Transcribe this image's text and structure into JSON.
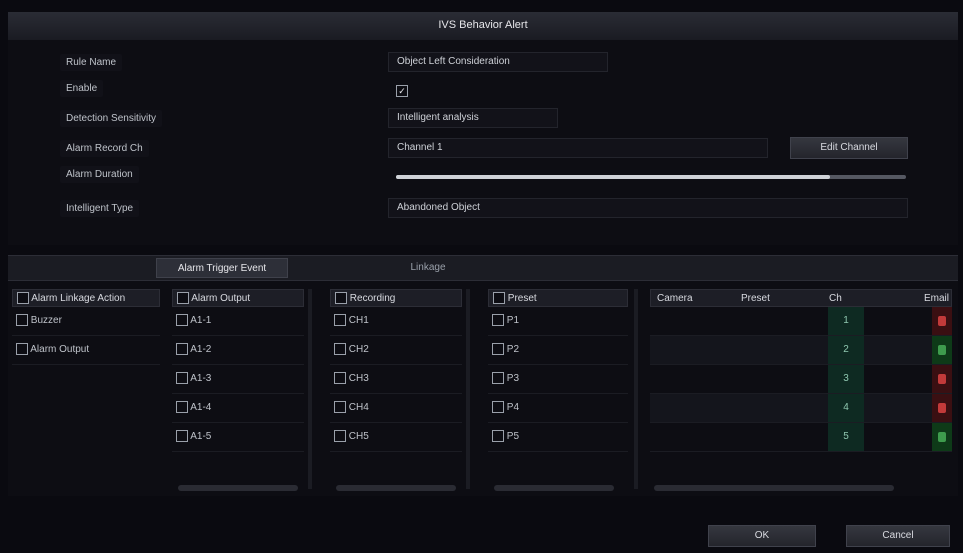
{
  "window": {
    "title": "IVS Behavior Alert"
  },
  "form": {
    "rows": [
      {
        "label": "Rule Name",
        "value": "Object Left Consideration"
      },
      {
        "label": "Enable",
        "checked": true
      },
      {
        "label": "Detection Sensitivity",
        "value": "Intelligent analysis"
      },
      {
        "label": "Alarm Record Ch",
        "value": "Channel 1",
        "button": "Edit Channel"
      },
      {
        "label": "Alarm Duration",
        "slider": 0.85
      },
      {
        "label": "Intelligent Type",
        "value": "Abandoned Object"
      }
    ]
  },
  "tabs": [
    {
      "label": "",
      "active": false
    },
    {
      "label": "Alarm Trigger Event",
      "active": true
    },
    {
      "label": "Linkage",
      "active": false
    }
  ],
  "columns": [
    {
      "head": "Alarm Linkage Action",
      "items": [
        "Buzzer",
        "Alarm Output"
      ]
    },
    {
      "head": "Alarm Output",
      "items": [
        "A1-1",
        "A1-2",
        "A1-3",
        "A1-4",
        "A1-5"
      ]
    },
    {
      "head": "Recording",
      "items": [
        "CH1",
        "CH2",
        "CH3",
        "CH4",
        "CH5"
      ]
    },
    {
      "head": "Preset",
      "items": [
        "P1",
        "P2",
        "P3",
        "P4",
        "P5"
      ]
    }
  ],
  "table": {
    "headers": [
      "Camera",
      "Preset",
      "Ch",
      "Email"
    ],
    "rows": [
      {
        "ch": "1",
        "email": "red"
      },
      {
        "ch": "2",
        "email": "green"
      },
      {
        "ch": "3",
        "email": "red"
      },
      {
        "ch": "4",
        "email": "red"
      },
      {
        "ch": "5",
        "email": "green"
      }
    ]
  },
  "footer": {
    "ok": "OK",
    "cancel": "Cancel"
  }
}
